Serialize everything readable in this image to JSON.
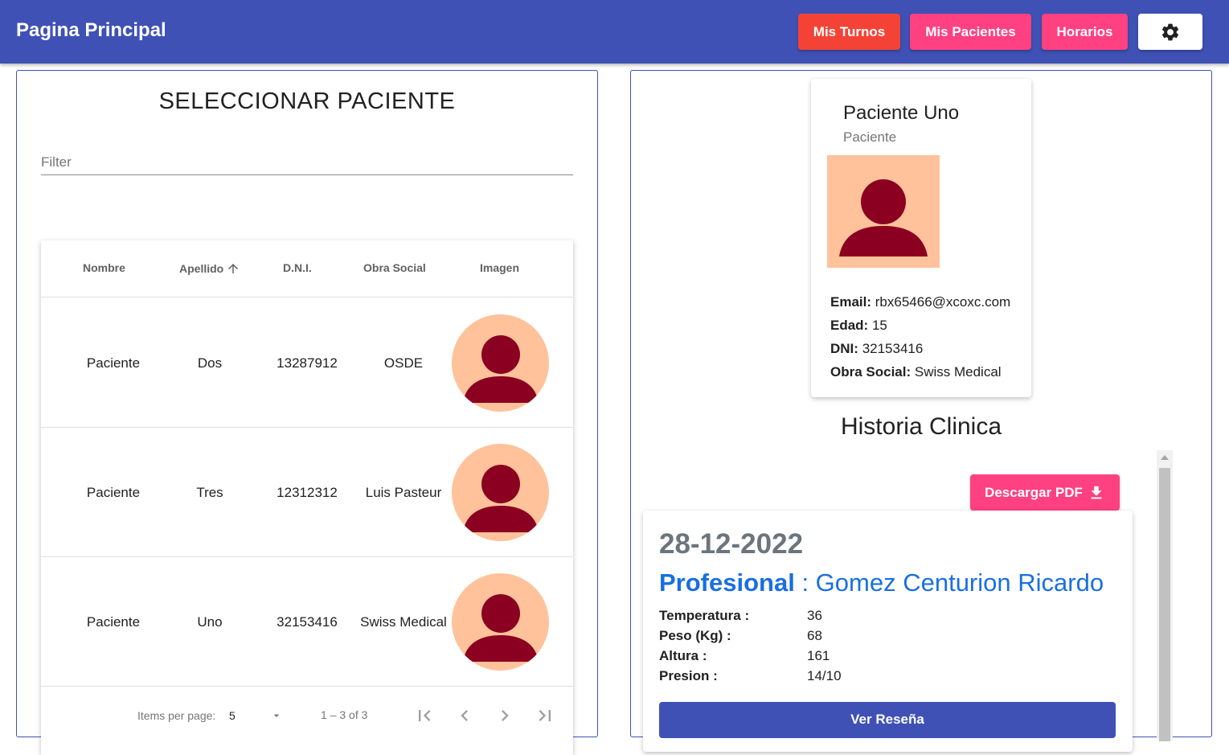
{
  "app": {
    "title": "Pagina Principal"
  },
  "toolbar": {
    "turnos_label": "Mis Turnos",
    "pacientes_label": "Mis Pacientes",
    "horarios_label": "Horarios",
    "settings_icon": "gear-icon"
  },
  "colors": {
    "primary": "#3f51b5",
    "accent": "#ff4081",
    "warn": "#f44336",
    "avatar_bg": "#ffc29a",
    "avatar_fg": "#8b0020",
    "profesional": "#1a6fe0"
  },
  "left_panel": {
    "title": "SELECCIONAR PACIENTE",
    "filter_placeholder": "Filter",
    "filter_value": "",
    "columns": [
      "Nombre",
      "Apellido",
      "D.N.I.",
      "Obra Social",
      "Imagen"
    ],
    "sort_icon": "arrow-up-icon",
    "rows": [
      {
        "nombre": "Paciente",
        "apellido": "Dos",
        "dni": "13287912",
        "obra_social": "OSDE"
      },
      {
        "nombre": "Paciente",
        "apellido": "Tres",
        "dni": "12312312",
        "obra_social": "Luis Pasteur"
      },
      {
        "nombre": "Paciente",
        "apellido": "Uno",
        "dni": "32153416",
        "obra_social": "Swiss Medical"
      }
    ],
    "paginator": {
      "items_label": "Items per page:",
      "page_size": "5",
      "range": "1 – 3 of 3"
    }
  },
  "profile": {
    "name": "Paciente Uno",
    "role": "Paciente",
    "email_label": "Email:",
    "email": "rbx65466@xcoxc.com",
    "edad_label": "Edad:",
    "edad": "15",
    "dni_label": "DNI:",
    "dni": "32153416",
    "obra_label": "Obra Social:",
    "obra": "Swiss Medical"
  },
  "historia": {
    "title": "Historia Clinica",
    "pdf_label": "Descargar PDF",
    "date": "28-12-2022",
    "prof_label": "Profesional",
    "prof_name": ": Gomez Centurion Ricardo",
    "fields": [
      {
        "key": "Temperatura :",
        "value": "36"
      },
      {
        "key": "Peso (Kg) :",
        "value": "68"
      },
      {
        "key": "Altura :",
        "value": "161"
      },
      {
        "key": "Presion :",
        "value": "14/10"
      }
    ],
    "resena_label": "Ver Reseña"
  }
}
